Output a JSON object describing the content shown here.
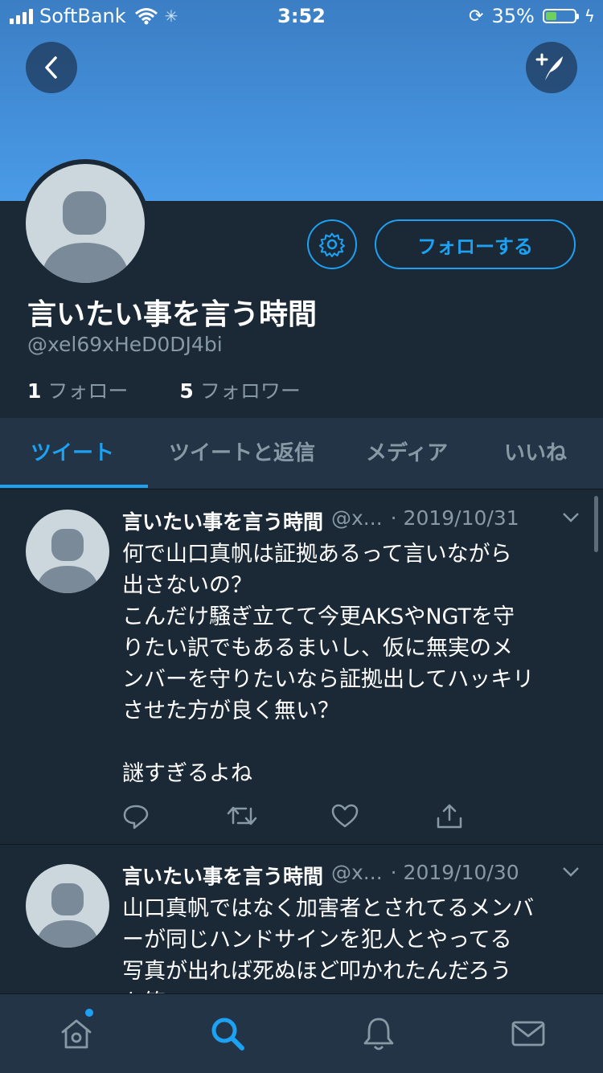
{
  "status_bar": {
    "carrier": "SoftBank",
    "time": "3:52",
    "battery": "35%"
  },
  "profile": {
    "name": "言いたい事を言う時間",
    "handle": "@xel69xHeD0DJ4bi",
    "following_count": "1",
    "following_label": "フォロー",
    "followers_count": "5",
    "followers_label": "フォロワー",
    "follow_button": "フォローする"
  },
  "tabs": [
    {
      "label": "ツイート"
    },
    {
      "label": "ツイートと返信"
    },
    {
      "label": "メディア"
    },
    {
      "label": "いいね"
    }
  ],
  "tweets": [
    {
      "name": "言いたい事を言う時間",
      "handle": "@x...",
      "date": "· 2019/10/31",
      "body": "何で山口真帆は証拠あるって言いながら\n出さないの？\nこんだけ騒ぎ立てて今更AKSやNGTを守\nりたい訳でもあるまいし、仮に無実のメ\nンバーを守りたいなら証拠出してハッキリ\nさせた方が良く無い？\n\n謎すぎるよね"
    },
    {
      "name": "言いたい事を言う時間",
      "handle": "@x...",
      "date": "· 2019/10/30",
      "body": "山口真帆ではなく加害者とされてるメンバ\nーが同じハンドサインを犯人とやってる\n写真が出れば死ぬほど叩かれたんだろう\nな笑"
    }
  ],
  "icons": {
    "back": "back-arrow-icon",
    "compose": "compose-tweet-icon",
    "settings": "gear-icon",
    "reply": "reply-icon",
    "retweet": "retweet-icon",
    "like": "heart-icon",
    "share": "share-icon",
    "home": "home-icon",
    "search": "search-icon",
    "notifications": "bell-icon",
    "messages": "mail-icon"
  },
  "colors": {
    "accent": "#1da1f2",
    "background": "#1b2836",
    "banner": "#4a9be8"
  }
}
